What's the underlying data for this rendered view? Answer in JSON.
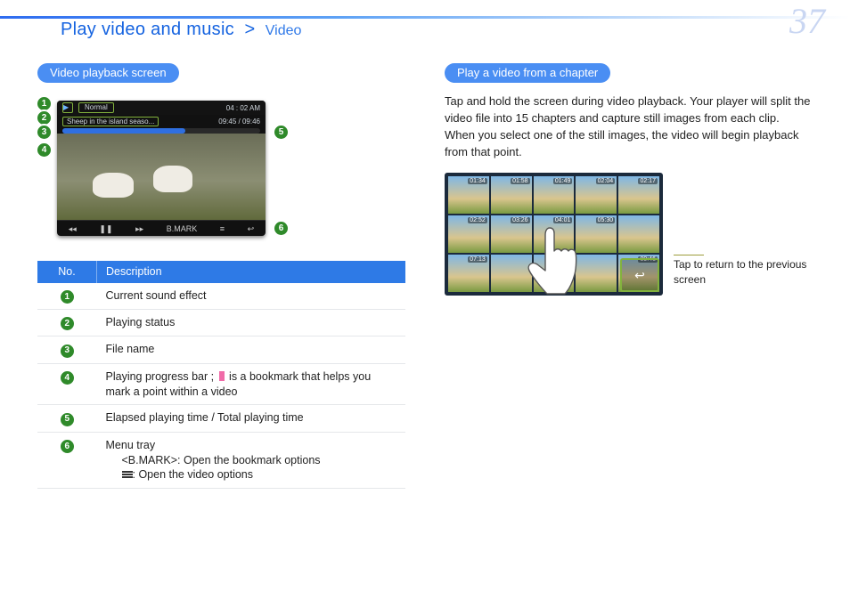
{
  "page_number": "37",
  "breadcrumb": {
    "main": "Play video and music",
    "chevron": ">",
    "sub": "Video"
  },
  "left": {
    "heading": "Video playback screen",
    "shot": {
      "sound_mode": "Normal",
      "clock": "04 : 02 AM",
      "filename": "Sheep in the island seaso...",
      "elapsed": "09:45",
      "total": "09:46",
      "tray": {
        "prev": "◂◂",
        "pause": "❚❚",
        "next": "▸▸",
        "bmark": "B.MARK",
        "menu": "≡",
        "back": "↩"
      }
    },
    "table": {
      "head_no": "No.",
      "head_desc": "Description",
      "rows": [
        {
          "n": "1",
          "d": "Current sound effect"
        },
        {
          "n": "2",
          "d": "Playing status"
        },
        {
          "n": "3",
          "d": "File name"
        },
        {
          "n": "4",
          "d_pre": "Playing progress bar ; ",
          "d_post": " is a bookmark that helps you mark a point within a video"
        },
        {
          "n": "5",
          "d": "Elapsed playing time / Total playing time"
        },
        {
          "n": "6",
          "d_line1": "Menu tray",
          "d_line2_pre": "<B.MARK>: Open the bookmark options",
          "d_line3_post": ": Open the video options"
        }
      ]
    }
  },
  "right": {
    "heading": "Play a video from a chapter",
    "para": "Tap and hold the screen during video playback. Your player will split the video file into 15 chapters and capture still images from each clip. When you select one of the still images, the video will begin playback from that point.",
    "thumbs": [
      "01:34",
      "01:58",
      "01:49",
      "02:04",
      "02:17",
      "02:52",
      "03:26",
      "04:01",
      "05:30",
      " ",
      "07:13",
      " ",
      "00:19",
      " ",
      "09:46"
    ],
    "callout": "Tap to return to the previous screen",
    "return_glyph": "↩"
  }
}
